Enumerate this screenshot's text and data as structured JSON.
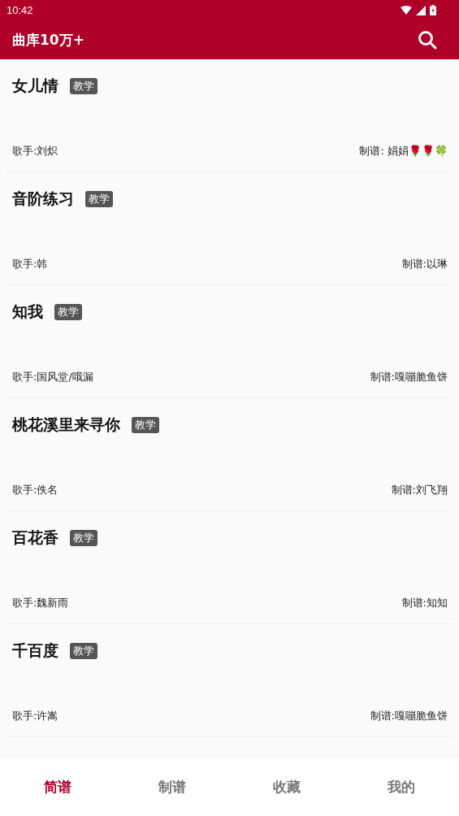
{
  "status_bar": {
    "time": "10:42"
  },
  "app_bar": {
    "title": "曲库10万+"
  },
  "songs": [
    {
      "title": "女儿情",
      "tag": "教学",
      "singer": "歌手:刘炽",
      "arranger": "制谱:  娟娟🌹🌹🍀"
    },
    {
      "title": "音阶练习",
      "tag": "教学",
      "singer": "歌手:韩",
      "arranger": "制谱:以琳"
    },
    {
      "title": "知我",
      "tag": "教学",
      "singer": "歌手:国风堂/哦漏",
      "arranger": "制谱:嘎嘣脆鱼饼"
    },
    {
      "title": "桃花溪里来寻你",
      "tag": "教学",
      "singer": "歌手:佚名",
      "arranger": "制谱:刘飞翔"
    },
    {
      "title": "百花香",
      "tag": "教学",
      "singer": "歌手:魏新雨",
      "arranger": "制谱:知知"
    },
    {
      "title": "千百度",
      "tag": "教学",
      "singer": "歌手:许嵩",
      "arranger": "制谱:嘎嘣脆鱼饼"
    }
  ],
  "bottom_nav": [
    {
      "label": "简谱",
      "selected": true
    },
    {
      "label": "制谱",
      "selected": false
    },
    {
      "label": "收藏",
      "selected": false
    },
    {
      "label": "我的",
      "selected": false
    }
  ]
}
